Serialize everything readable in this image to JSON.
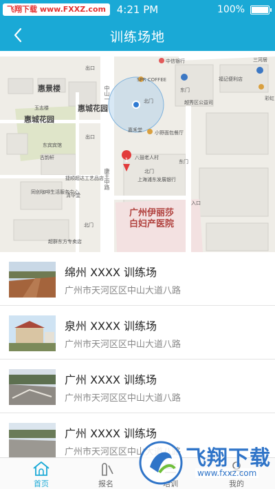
{
  "status_bar": {
    "watermark": "飞翔下载 www.FXXZ.com",
    "time": "4:21 PM",
    "battery": "100%"
  },
  "nav": {
    "title": "训练场地",
    "back_icon": "chevron-left-icon"
  },
  "map": {
    "labels": {
      "huijing": "惠景楼",
      "yuzhi": "玉志楼",
      "huichengyuan_lou": "惠城花园",
      "huichenghuayuan": "惠城花园",
      "dongbinbinguan": "东宾宾馆",
      "gumiaoxuan": "古韵轩",
      "kangwang": "康王",
      "chukou1": "出口",
      "chukou2": "出口",
      "dongmen": "东门",
      "beimen": "北门",
      "spr": "SPR COFFEE",
      "zhongxin_bank": "中信银行",
      "dongmen2": "东门",
      "sifangtang": "嘉禾堂",
      "zhongshanyi": "中山一",
      "xiaoyemian": "小野面包餐厅",
      "bafu": "八鼓老人村",
      "beimen2": "北门",
      "rukou": "入口",
      "shanghai": "上海浦东发展银行",
      "jingqiao": "捷顺超达工艺品店",
      "tongyi": "同创咖啡生活服务中心",
      "qingshenghua": "清华堂",
      "beimen3": "北门",
      "chaojun": "超群东方专卖店",
      "guangzhou_hospital": "广州伊丽莎\n白妇产医院",
      "kangwang_road": "康王中路",
      "sanhe": "三河居",
      "caihong": "彩虹",
      "fuyuan": "福记便利店",
      "bingzheng": "东门",
      "yushang": "越秀区公益司"
    }
  },
  "list": [
    {
      "title": "绵州 XXXX 训练场",
      "address": "广州市天河区区中山大道八路"
    },
    {
      "title": "泉州 XXXX 训练场",
      "address": "广州市天河区区中山大道八路"
    },
    {
      "title": "广州 XXXX 训练场",
      "address": "广州市天河区区中山大道八路"
    },
    {
      "title": "广州 XXXX 训练场",
      "address": "广州市天河区区中山大道八路"
    }
  ],
  "tabs": [
    {
      "label": "首页",
      "icon": "home-icon",
      "active": true
    },
    {
      "label": "报名",
      "icon": "pen-icon",
      "active": false
    },
    {
      "label": "培训",
      "icon": "list-icon",
      "active": false
    },
    {
      "label": "我的",
      "icon": "user-icon",
      "active": false
    }
  ],
  "watermark_br": {
    "brand": "飞翔下载",
    "url": "www.fxxz.com"
  },
  "colors": {
    "primary": "#1aa9d6",
    "hospital": "#b0413e"
  }
}
